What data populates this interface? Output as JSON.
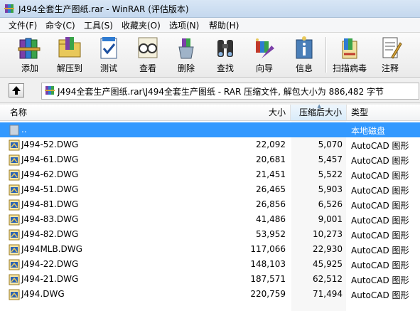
{
  "window": {
    "title": "J494全套生产图纸.rar - WinRAR (评估版本)"
  },
  "menu": {
    "items": [
      {
        "label": "文件(F)"
      },
      {
        "label": "命令(C)"
      },
      {
        "label": "工具(S)"
      },
      {
        "label": "收藏夹(O)"
      },
      {
        "label": "选项(N)"
      },
      {
        "label": "帮助(H)"
      }
    ]
  },
  "toolbar": {
    "buttons": [
      {
        "label": "添加",
        "icon": "books-add-icon"
      },
      {
        "label": "解压到",
        "icon": "folder-extract-icon"
      },
      {
        "label": "测试",
        "icon": "clipboard-check-icon"
      },
      {
        "label": "查看",
        "icon": "glasses-view-icon"
      },
      {
        "label": "删除",
        "icon": "recycle-delete-icon"
      },
      {
        "label": "查找",
        "icon": "binoculars-find-icon"
      },
      {
        "label": "向导",
        "icon": "wizard-icon"
      },
      {
        "label": "信息",
        "icon": "info-icon"
      },
      {
        "label": "扫描病毒",
        "icon": "scan-virus-icon"
      },
      {
        "label": "注释",
        "icon": "comment-icon"
      }
    ]
  },
  "address": {
    "path": "J494全套生产图纸.rar\\J494全套生产图纸 - RAR 压缩文件, 解包大小为 886,482 字节"
  },
  "columns": {
    "name": "名称",
    "size": "大小",
    "packed": "压缩后大小",
    "type": "类型"
  },
  "files": [
    {
      "name": "..",
      "size": "",
      "packed": "",
      "type": "本地磁盘",
      "selected": true,
      "icon": "folder-up-icon"
    },
    {
      "name": "J494-52.DWG",
      "size": "22,092",
      "packed": "5,070",
      "type": "AutoCAD 图形",
      "icon": "dwg-file-icon"
    },
    {
      "name": "J494-61.DWG",
      "size": "20,681",
      "packed": "5,457",
      "type": "AutoCAD 图形",
      "icon": "dwg-file-icon"
    },
    {
      "name": "J494-62.DWG",
      "size": "21,451",
      "packed": "5,522",
      "type": "AutoCAD 图形",
      "icon": "dwg-file-icon"
    },
    {
      "name": "J494-51.DWG",
      "size": "26,465",
      "packed": "5,903",
      "type": "AutoCAD 图形",
      "icon": "dwg-file-icon"
    },
    {
      "name": "J494-81.DWG",
      "size": "26,856",
      "packed": "6,526",
      "type": "AutoCAD 图形",
      "icon": "dwg-file-icon"
    },
    {
      "name": "J494-83.DWG",
      "size": "41,486",
      "packed": "9,001",
      "type": "AutoCAD 图形",
      "icon": "dwg-file-icon"
    },
    {
      "name": "J494-82.DWG",
      "size": "53,952",
      "packed": "10,273",
      "type": "AutoCAD 图形",
      "icon": "dwg-file-icon"
    },
    {
      "name": "J494MLB.DWG",
      "size": "117,066",
      "packed": "22,930",
      "type": "AutoCAD 图形",
      "icon": "dwg-file-icon"
    },
    {
      "name": "J494-22.DWG",
      "size": "148,103",
      "packed": "45,925",
      "type": "AutoCAD 图形",
      "icon": "dwg-file-icon"
    },
    {
      "name": "J494-21.DWG",
      "size": "187,571",
      "packed": "62,512",
      "type": "AutoCAD 图形",
      "icon": "dwg-file-icon"
    },
    {
      "name": "J494.DWG",
      "size": "220,759",
      "packed": "71,494",
      "type": "AutoCAD 图形",
      "icon": "dwg-file-icon"
    }
  ]
}
